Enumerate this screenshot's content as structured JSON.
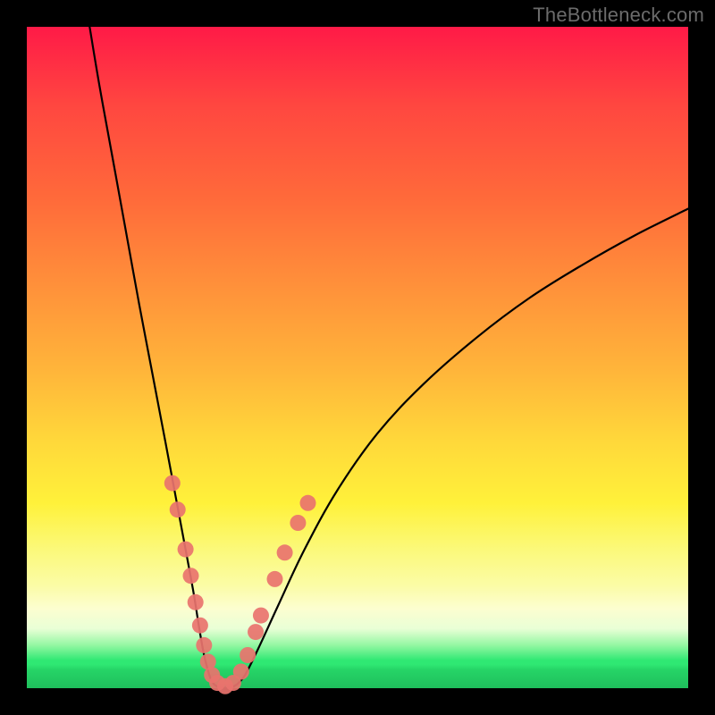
{
  "watermark": "TheBottleneck.com",
  "chart_data": {
    "type": "line",
    "title": "",
    "xlabel": "",
    "ylabel": "",
    "xlim": [
      0,
      100
    ],
    "ylim": [
      0,
      100
    ],
    "grid": false,
    "legend": false,
    "series": [
      {
        "name": "left-branch",
        "x": [
          9.5,
          11,
          13,
          15,
          17,
          19,
          21,
          22.5,
          24,
          25.2,
          26,
          26.7,
          27.3,
          27.8,
          28.3
        ],
        "values": [
          100,
          91,
          80,
          69,
          58,
          47.5,
          37,
          29,
          21,
          14.5,
          9.5,
          5.5,
          3,
          1.4,
          0.6
        ]
      },
      {
        "name": "valley-floor",
        "x": [
          28.3,
          29,
          30,
          31,
          31.8
        ],
        "values": [
          0.6,
          0.15,
          0.05,
          0.15,
          0.6
        ]
      },
      {
        "name": "right-branch",
        "x": [
          31.8,
          33,
          35,
          38,
          42,
          47,
          53,
          60,
          68,
          76,
          84,
          92,
          100
        ],
        "values": [
          0.6,
          2,
          6,
          12.5,
          21,
          30,
          38.5,
          46,
          53,
          59,
          64,
          68.5,
          72.5
        ]
      }
    ],
    "annotations": {
      "scatter_dots": [
        {
          "x": 22.0,
          "y": 31.0
        },
        {
          "x": 22.8,
          "y": 27.0
        },
        {
          "x": 24.0,
          "y": 21.0
        },
        {
          "x": 24.8,
          "y": 17.0
        },
        {
          "x": 25.5,
          "y": 13.0
        },
        {
          "x": 26.2,
          "y": 9.5
        },
        {
          "x": 26.8,
          "y": 6.5
        },
        {
          "x": 27.4,
          "y": 4.0
        },
        {
          "x": 28.0,
          "y": 2.0
        },
        {
          "x": 28.8,
          "y": 0.8
        },
        {
          "x": 30.0,
          "y": 0.3
        },
        {
          "x": 31.2,
          "y": 0.8
        },
        {
          "x": 32.4,
          "y": 2.5
        },
        {
          "x": 33.4,
          "y": 5.0
        },
        {
          "x": 34.6,
          "y": 8.5
        },
        {
          "x": 35.4,
          "y": 11.0
        },
        {
          "x": 37.5,
          "y": 16.5
        },
        {
          "x": 39.0,
          "y": 20.5
        },
        {
          "x": 41.0,
          "y": 25.0
        },
        {
          "x": 42.5,
          "y": 28.0
        }
      ],
      "gradient_bands": [
        {
          "color": "#ff1a47",
          "y_percent_from_top": 0
        },
        {
          "color": "#ffd93a",
          "y_percent_from_top": 63
        },
        {
          "color": "#fbfca6",
          "y_percent_from_top": 85
        },
        {
          "color": "#2fe873",
          "y_percent_from_top": 96
        },
        {
          "color": "#1fbf5c",
          "y_percent_from_top": 100
        }
      ]
    }
  }
}
